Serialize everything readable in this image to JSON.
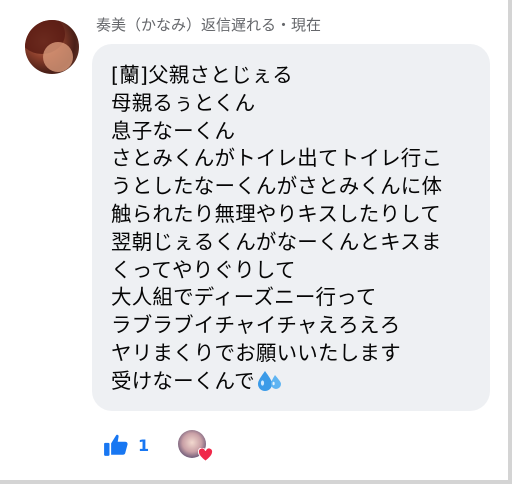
{
  "post": {
    "header": "奏美（かなみ）返信遅れる・現在",
    "message_lines": [
      "[蘭]父親さとじぇる",
      "母親るぅとくん",
      "息子なーくん",
      "さとみくんがトイレ出てトイレ行こ",
      "うとしたなーくんがさとみくんに体",
      "触られたり無理やりキスしたりして",
      "翌朝じぇるくんがなーくんとキスま",
      "くってやりぐりして",
      "大人組でディーズニー行って",
      "ラブラブイチャイチャえろえろ",
      "ヤリまくりでお願いいたします",
      "受けなーくんで"
    ],
    "trailing_emoji": "sweat-droplets-icon"
  },
  "reactions": {
    "like_count": "1",
    "like_icon": "thumbs-up-icon",
    "heart_icon": "heart-icon"
  },
  "colors": {
    "bubble": "#eef0f3",
    "accent": "#1877f2",
    "meta_text": "#65676b",
    "heart": "#f02849"
  }
}
